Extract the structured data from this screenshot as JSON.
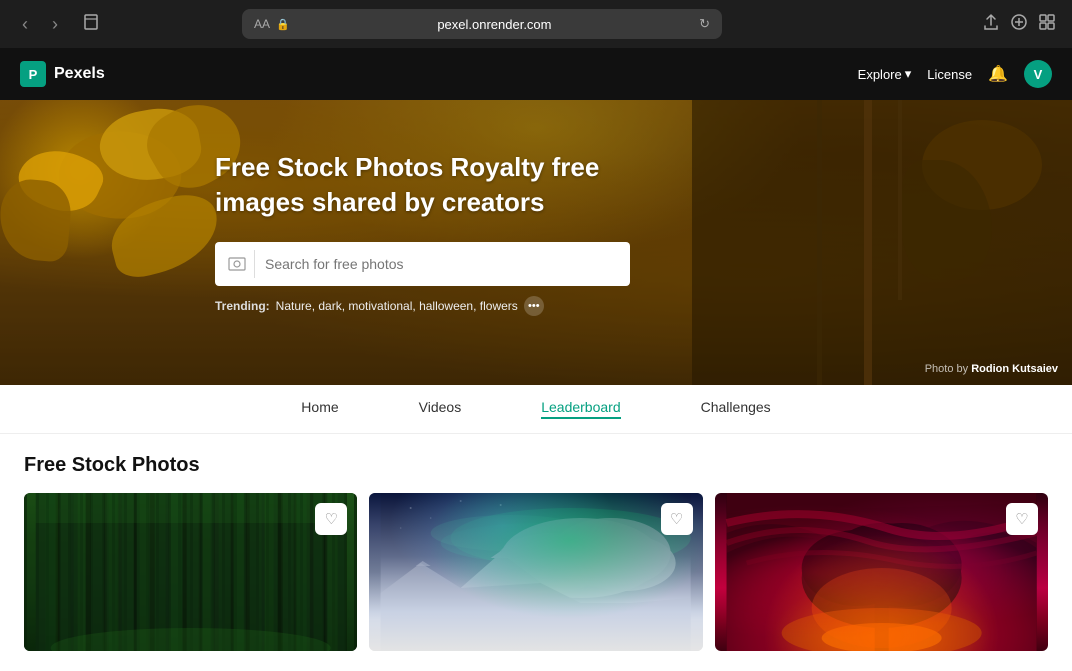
{
  "browser": {
    "back_label": "‹",
    "forward_label": "›",
    "bookmarks_label": "□",
    "aa_label": "AA",
    "lock_icon": "🔒",
    "url": "pexel.onrender.com",
    "reload_icon": "↻",
    "share_icon": "⬆",
    "new_tab_icon": "+",
    "tabs_icon": "⧉"
  },
  "navbar": {
    "logo_letter": "P",
    "brand_name": "Pexels",
    "explore_label": "Explore",
    "explore_arrow": "▾",
    "license_label": "License",
    "bell_icon": "🔔",
    "avatar_letter": "V"
  },
  "hero": {
    "title": "Free Stock Photos Royalty free images shared by creators",
    "search_placeholder": "Search for free photos",
    "trending_label": "Trending:",
    "trending_terms": "Nature, dark, motivational, halloween, flowers",
    "photo_credit_prefix": "Photo by",
    "photographer_name": "Rodion Kutsaiev"
  },
  "tabs": [
    {
      "label": "Home",
      "active": false
    },
    {
      "label": "Videos",
      "active": false
    },
    {
      "label": "Leaderboard",
      "active": true
    },
    {
      "label": "Challenges",
      "active": false
    }
  ],
  "section_title": "Free Stock Photos",
  "photos": [
    {
      "id": 1,
      "alt": "Green forest with tall trees",
      "type": "forest"
    },
    {
      "id": 2,
      "alt": "Aurora borealis over mountains",
      "type": "aurora"
    },
    {
      "id": 3,
      "alt": "Red dramatic sky with tree silhouette",
      "type": "redsky"
    }
  ]
}
